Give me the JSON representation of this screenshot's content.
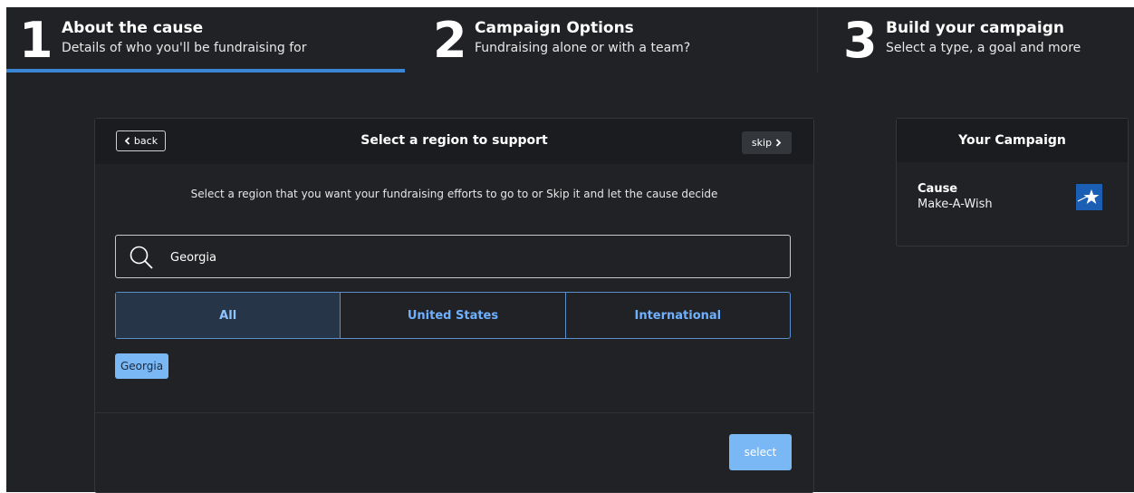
{
  "steps": [
    {
      "number": "1",
      "title": "About the cause",
      "subtitle": "Details of who you'll be fundraising for"
    },
    {
      "number": "2",
      "title": "Campaign Options",
      "subtitle": "Fundraising alone or with a team?"
    },
    {
      "number": "3",
      "title": "Build your campaign",
      "subtitle": "Select a type, a goal and more"
    }
  ],
  "card": {
    "back_label": "back",
    "title": "Select a region to support",
    "skip_label": "skip",
    "instruction": "Select a region that you want your fundraising efforts to go to or Skip it and let the cause decide",
    "search": {
      "value": "Georgia",
      "icon": "search-icon"
    },
    "tabs": [
      {
        "label": "All",
        "active": true
      },
      {
        "label": "United States",
        "active": false
      },
      {
        "label": "International",
        "active": false
      }
    ],
    "results": [
      "Georgia"
    ],
    "select_label": "select"
  },
  "campaign": {
    "title": "Your Campaign",
    "cause_label": "Cause",
    "cause_value": "Make-A-Wish",
    "logo_icon": "make-a-wish-star-icon"
  },
  "colors": {
    "background": "#202225",
    "accent": "#3a86d4",
    "tab_text": "#6fb1ff",
    "button": "#7ab8f5"
  }
}
